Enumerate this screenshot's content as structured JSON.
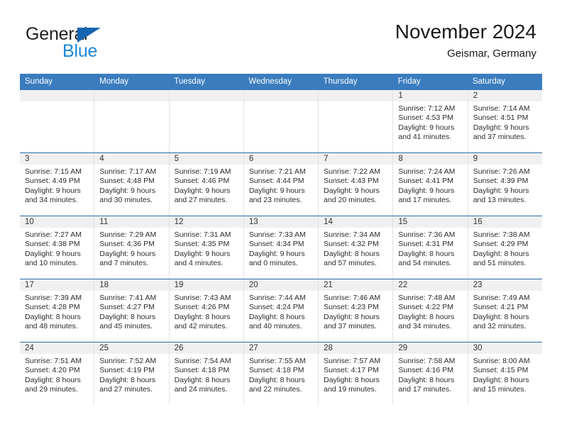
{
  "brand": {
    "name_part1": "General",
    "name_part2": "Blue",
    "triangle_color": "#1565b0",
    "blue_color": "#1b87d8"
  },
  "header": {
    "title": "November 2024",
    "subtitle": "Geismar, Germany"
  },
  "colors": {
    "weekday_header_bg": "#3a7cbe",
    "week_separator": "#2b6cad",
    "day_band_bg": "#f0f0f0",
    "cell_border": "#e3e3e3"
  },
  "weekdays": [
    {
      "label": "Sunday"
    },
    {
      "label": "Monday"
    },
    {
      "label": "Tuesday"
    },
    {
      "label": "Wednesday"
    },
    {
      "label": "Thursday"
    },
    {
      "label": "Friday"
    },
    {
      "label": "Saturday"
    }
  ],
  "weeks": [
    {
      "days": [
        {
          "number": "",
          "empty": true,
          "sunrise": "",
          "sunset": "",
          "daylight_line1": "",
          "daylight_line2": ""
        },
        {
          "number": "",
          "empty": true,
          "sunrise": "",
          "sunset": "",
          "daylight_line1": "",
          "daylight_line2": ""
        },
        {
          "number": "",
          "empty": true,
          "sunrise": "",
          "sunset": "",
          "daylight_line1": "",
          "daylight_line2": ""
        },
        {
          "number": "",
          "empty": true,
          "sunrise": "",
          "sunset": "",
          "daylight_line1": "",
          "daylight_line2": ""
        },
        {
          "number": "",
          "empty": true,
          "sunrise": "",
          "sunset": "",
          "daylight_line1": "",
          "daylight_line2": ""
        },
        {
          "number": "1",
          "empty": false,
          "sunrise": "Sunrise: 7:12 AM",
          "sunset": "Sunset: 4:53 PM",
          "daylight_line1": "Daylight: 9 hours",
          "daylight_line2": "and 41 minutes."
        },
        {
          "number": "2",
          "empty": false,
          "sunrise": "Sunrise: 7:14 AM",
          "sunset": "Sunset: 4:51 PM",
          "daylight_line1": "Daylight: 9 hours",
          "daylight_line2": "and 37 minutes."
        }
      ]
    },
    {
      "days": [
        {
          "number": "3",
          "empty": false,
          "sunrise": "Sunrise: 7:15 AM",
          "sunset": "Sunset: 4:49 PM",
          "daylight_line1": "Daylight: 9 hours",
          "daylight_line2": "and 34 minutes."
        },
        {
          "number": "4",
          "empty": false,
          "sunrise": "Sunrise: 7:17 AM",
          "sunset": "Sunset: 4:48 PM",
          "daylight_line1": "Daylight: 9 hours",
          "daylight_line2": "and 30 minutes."
        },
        {
          "number": "5",
          "empty": false,
          "sunrise": "Sunrise: 7:19 AM",
          "sunset": "Sunset: 4:46 PM",
          "daylight_line1": "Daylight: 9 hours",
          "daylight_line2": "and 27 minutes."
        },
        {
          "number": "6",
          "empty": false,
          "sunrise": "Sunrise: 7:21 AM",
          "sunset": "Sunset: 4:44 PM",
          "daylight_line1": "Daylight: 9 hours",
          "daylight_line2": "and 23 minutes."
        },
        {
          "number": "7",
          "empty": false,
          "sunrise": "Sunrise: 7:22 AM",
          "sunset": "Sunset: 4:43 PM",
          "daylight_line1": "Daylight: 9 hours",
          "daylight_line2": "and 20 minutes."
        },
        {
          "number": "8",
          "empty": false,
          "sunrise": "Sunrise: 7:24 AM",
          "sunset": "Sunset: 4:41 PM",
          "daylight_line1": "Daylight: 9 hours",
          "daylight_line2": "and 17 minutes."
        },
        {
          "number": "9",
          "empty": false,
          "sunrise": "Sunrise: 7:26 AM",
          "sunset": "Sunset: 4:39 PM",
          "daylight_line1": "Daylight: 9 hours",
          "daylight_line2": "and 13 minutes."
        }
      ]
    },
    {
      "days": [
        {
          "number": "10",
          "empty": false,
          "sunrise": "Sunrise: 7:27 AM",
          "sunset": "Sunset: 4:38 PM",
          "daylight_line1": "Daylight: 9 hours",
          "daylight_line2": "and 10 minutes."
        },
        {
          "number": "11",
          "empty": false,
          "sunrise": "Sunrise: 7:29 AM",
          "sunset": "Sunset: 4:36 PM",
          "daylight_line1": "Daylight: 9 hours",
          "daylight_line2": "and 7 minutes."
        },
        {
          "number": "12",
          "empty": false,
          "sunrise": "Sunrise: 7:31 AM",
          "sunset": "Sunset: 4:35 PM",
          "daylight_line1": "Daylight: 9 hours",
          "daylight_line2": "and 4 minutes."
        },
        {
          "number": "13",
          "empty": false,
          "sunrise": "Sunrise: 7:33 AM",
          "sunset": "Sunset: 4:34 PM",
          "daylight_line1": "Daylight: 9 hours",
          "daylight_line2": "and 0 minutes."
        },
        {
          "number": "14",
          "empty": false,
          "sunrise": "Sunrise: 7:34 AM",
          "sunset": "Sunset: 4:32 PM",
          "daylight_line1": "Daylight: 8 hours",
          "daylight_line2": "and 57 minutes."
        },
        {
          "number": "15",
          "empty": false,
          "sunrise": "Sunrise: 7:36 AM",
          "sunset": "Sunset: 4:31 PM",
          "daylight_line1": "Daylight: 8 hours",
          "daylight_line2": "and 54 minutes."
        },
        {
          "number": "16",
          "empty": false,
          "sunrise": "Sunrise: 7:38 AM",
          "sunset": "Sunset: 4:29 PM",
          "daylight_line1": "Daylight: 8 hours",
          "daylight_line2": "and 51 minutes."
        }
      ]
    },
    {
      "days": [
        {
          "number": "17",
          "empty": false,
          "sunrise": "Sunrise: 7:39 AM",
          "sunset": "Sunset: 4:28 PM",
          "daylight_line1": "Daylight: 8 hours",
          "daylight_line2": "and 48 minutes."
        },
        {
          "number": "18",
          "empty": false,
          "sunrise": "Sunrise: 7:41 AM",
          "sunset": "Sunset: 4:27 PM",
          "daylight_line1": "Daylight: 8 hours",
          "daylight_line2": "and 45 minutes."
        },
        {
          "number": "19",
          "empty": false,
          "sunrise": "Sunrise: 7:43 AM",
          "sunset": "Sunset: 4:26 PM",
          "daylight_line1": "Daylight: 8 hours",
          "daylight_line2": "and 42 minutes."
        },
        {
          "number": "20",
          "empty": false,
          "sunrise": "Sunrise: 7:44 AM",
          "sunset": "Sunset: 4:24 PM",
          "daylight_line1": "Daylight: 8 hours",
          "daylight_line2": "and 40 minutes."
        },
        {
          "number": "21",
          "empty": false,
          "sunrise": "Sunrise: 7:46 AM",
          "sunset": "Sunset: 4:23 PM",
          "daylight_line1": "Daylight: 8 hours",
          "daylight_line2": "and 37 minutes."
        },
        {
          "number": "22",
          "empty": false,
          "sunrise": "Sunrise: 7:48 AM",
          "sunset": "Sunset: 4:22 PM",
          "daylight_line1": "Daylight: 8 hours",
          "daylight_line2": "and 34 minutes."
        },
        {
          "number": "23",
          "empty": false,
          "sunrise": "Sunrise: 7:49 AM",
          "sunset": "Sunset: 4:21 PM",
          "daylight_line1": "Daylight: 8 hours",
          "daylight_line2": "and 32 minutes."
        }
      ]
    },
    {
      "days": [
        {
          "number": "24",
          "empty": false,
          "sunrise": "Sunrise: 7:51 AM",
          "sunset": "Sunset: 4:20 PM",
          "daylight_line1": "Daylight: 8 hours",
          "daylight_line2": "and 29 minutes."
        },
        {
          "number": "25",
          "empty": false,
          "sunrise": "Sunrise: 7:52 AM",
          "sunset": "Sunset: 4:19 PM",
          "daylight_line1": "Daylight: 8 hours",
          "daylight_line2": "and 27 minutes."
        },
        {
          "number": "26",
          "empty": false,
          "sunrise": "Sunrise: 7:54 AM",
          "sunset": "Sunset: 4:18 PM",
          "daylight_line1": "Daylight: 8 hours",
          "daylight_line2": "and 24 minutes."
        },
        {
          "number": "27",
          "empty": false,
          "sunrise": "Sunrise: 7:55 AM",
          "sunset": "Sunset: 4:18 PM",
          "daylight_line1": "Daylight: 8 hours",
          "daylight_line2": "and 22 minutes."
        },
        {
          "number": "28",
          "empty": false,
          "sunrise": "Sunrise: 7:57 AM",
          "sunset": "Sunset: 4:17 PM",
          "daylight_line1": "Daylight: 8 hours",
          "daylight_line2": "and 19 minutes."
        },
        {
          "number": "29",
          "empty": false,
          "sunrise": "Sunrise: 7:58 AM",
          "sunset": "Sunset: 4:16 PM",
          "daylight_line1": "Daylight: 8 hours",
          "daylight_line2": "and 17 minutes."
        },
        {
          "number": "30",
          "empty": false,
          "sunrise": "Sunrise: 8:00 AM",
          "sunset": "Sunset: 4:15 PM",
          "daylight_line1": "Daylight: 8 hours",
          "daylight_line2": "and 15 minutes."
        }
      ]
    }
  ]
}
